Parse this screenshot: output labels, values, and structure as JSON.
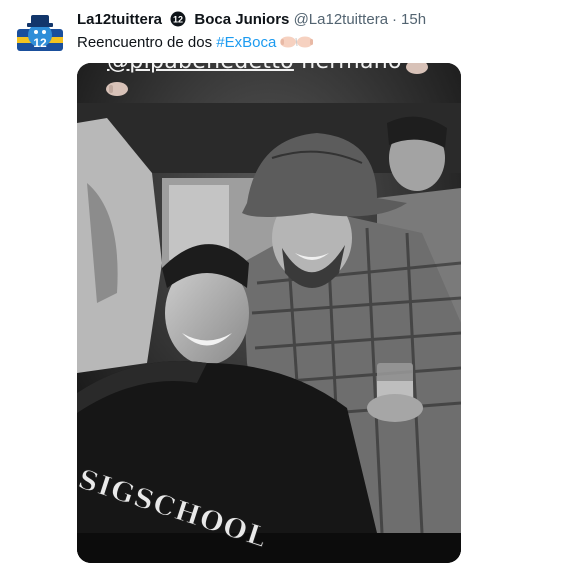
{
  "tweet": {
    "display_name": "La12tuittera",
    "affiliation": "Boca Juniors",
    "handle": "@La12tuittera",
    "separator": "·",
    "time": "15h",
    "text": "Reencuentro de dos ",
    "hashtag": "#ExBoca",
    "emoji_name": "fist-bump-emoji",
    "avatar_label": "12",
    "affiliation_badge_label": "12"
  },
  "media": {
    "overlay_mention": "@pipabenedetto",
    "overlay_word": " hermano",
    "shirt_text": "SIGSCHOOL"
  },
  "colors": {
    "hashtag": "#1d9bf0",
    "secondary_text": "#536471",
    "primary_text": "#0f1419",
    "avatar_blue": "#1a4f9c",
    "avatar_yellow": "#f3c320"
  }
}
